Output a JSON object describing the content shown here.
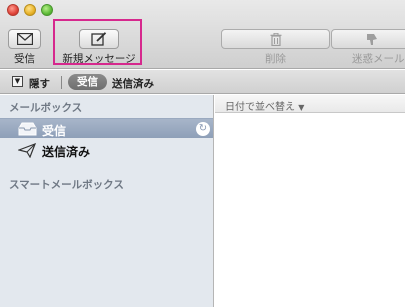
{
  "toolbar": {
    "inbox_label": "受信",
    "new_message_label": "新規メッセージ",
    "delete_label": "削除",
    "junk_label": "迷惑メール"
  },
  "filterbar": {
    "hide_label": "隠す",
    "inbox_filter": "受信",
    "sent_filter": "送信済み"
  },
  "sidebar": {
    "mailboxes_header": "メールボックス",
    "items": [
      {
        "label": "受信",
        "icon": "inbox-tray-icon",
        "selected": true
      },
      {
        "label": "送信済み",
        "icon": "paper-plane-icon",
        "selected": false
      }
    ],
    "smart_mailboxes_header": "スマートメールボックス"
  },
  "message_list": {
    "sort_label": "日付で並べ替え"
  },
  "colors": {
    "highlight_border": "#d6288d",
    "selection": "#9aa9bf",
    "sidebar_bg": "#e3e8ee"
  }
}
